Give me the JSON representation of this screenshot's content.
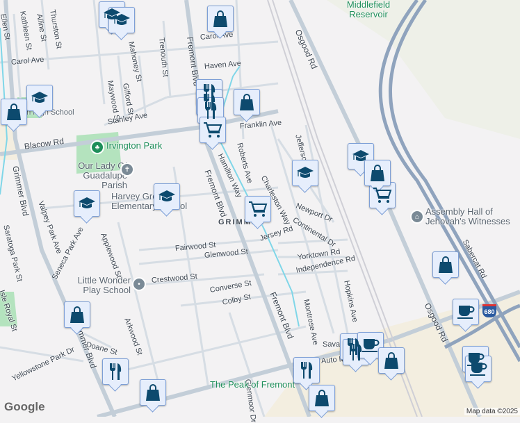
{
  "labels": [
    "Ellen St",
    "Kathleen St",
    "Alline St",
    "Thurston St",
    "Carol Ave",
    "Mahoney St",
    "Trenouth St",
    "Fremont Blvd",
    "Carol Ave",
    "Haven Ave",
    "Maywood St",
    "Gifford St",
    "Stanley Ave",
    "Blacow Rd",
    "Franklin Ave",
    "Roberts Ave",
    "Hamilton Way",
    "Fremont Blvd",
    "Charleston Way",
    "Jefferson St",
    "Newport Dr",
    "Continental Dr",
    "Jersey Rd",
    "Grimmer Blvd",
    "Valpey Park Ave",
    "Seneca Park Ave",
    "Saratoga Park St",
    "Applewood St",
    "Fairwood St",
    "Glenwood St",
    "Crestwood St",
    "Converse St",
    "Colby St",
    "Isle Royal St",
    "Yorktown Rd",
    "Independence Rd",
    "Hopkins Ave",
    "Montrose Ave",
    "Fremont Blvd",
    "Arkwood St",
    "Doane St",
    "Yellowstone Park Dr",
    "Grimmer Blvd",
    "Osgood Rd",
    "Osgood Rd",
    "Sabercat Rd",
    "Savannah",
    "Auto Mall Pkwy",
    "Glenmoor Dr"
  ],
  "places": {
    "irvington_park": "Irvington Park",
    "our_lady": "Our Lady Of Guadalupe Parish",
    "harvey_green": "Harvey Green Elementary School",
    "little_wonder": "Little Wonder Play School",
    "assembly_hall": "Assembly Hall of Jehovah's Witnesses",
    "peak": "The Peak of Fremont",
    "reservoir": "Middlefield Reservoir",
    "grimmer": "GRIMMER",
    "school_left": "Irvington High School"
  },
  "highway_shield": "680",
  "logo": "Google",
  "attribution": "Map data ©2025",
  "markers": [
    "school",
    "school",
    "bag",
    "school",
    "restaurant",
    "restaurant",
    "restaurant",
    "cart",
    "bag",
    "school",
    "school",
    "cart",
    "school",
    "bag",
    "cart",
    "school",
    "bag",
    "bag",
    "coffee",
    "coffee",
    "coffee",
    "restaurant",
    "restaurant",
    "coffee",
    "bag",
    "restaurant",
    "restaurant",
    "bag",
    "bag",
    "bag"
  ],
  "colors": {
    "marker_icon": "#0d4a6e",
    "marker_bg": "#e6eefc",
    "road": "#c9d3dc",
    "freeway": "#8fa3bd",
    "canal": "#7fd6e8",
    "park": "#b4e3be",
    "commercial": "#f3eee0"
  }
}
